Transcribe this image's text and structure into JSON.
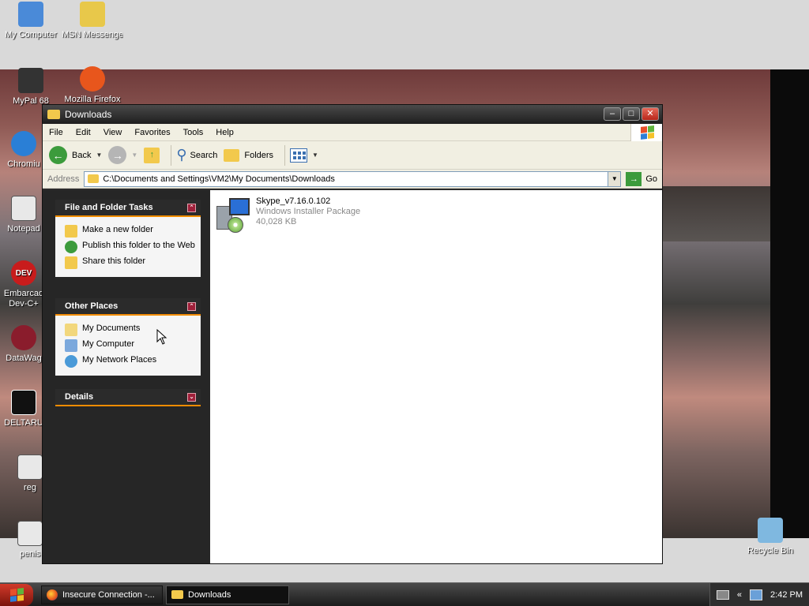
{
  "desktop": {
    "icons": [
      {
        "label": "My Computer",
        "icon": "computer-icon",
        "color": "#4a8ad8"
      },
      {
        "label": "MSN Messenger ...",
        "icon": "zip-folder-icon",
        "color": "#e8c84a"
      },
      {
        "label": "MyPal 68",
        "icon": "mypal-icon",
        "color": "#333333"
      },
      {
        "label": "Mozilla Firefox",
        "icon": "firefox-icon",
        "color": "#e8561c"
      },
      {
        "label": "Chromiu",
        "icon": "chromium-icon",
        "color": "#2a7fd6"
      },
      {
        "label": "Notepad",
        "icon": "notepad-icon",
        "color": "#e8e8e8"
      },
      {
        "label": "Embarcad Dev-C+",
        "icon": "devcpp-icon",
        "color": "#c81c1c",
        "badge": "DEV"
      },
      {
        "label": "DataWag",
        "icon": "datawagon-icon",
        "color": "#8a1c2c"
      },
      {
        "label": "DELTARU",
        "icon": "deltarune-icon",
        "color": "#111111"
      },
      {
        "label": "reg",
        "icon": "registry-icon",
        "color": "#e8e8e8"
      },
      {
        "label": "penis",
        "icon": "game-icon",
        "color": "#e8e8e8"
      },
      {
        "label": "Recycle Bin",
        "icon": "recycle-bin-icon",
        "color": "#7fb8e0"
      }
    ]
  },
  "window": {
    "title": "Downloads",
    "minimize": "–",
    "maximize": "□",
    "close": "✕"
  },
  "menu": [
    "File",
    "Edit",
    "View",
    "Favorites",
    "Tools",
    "Help"
  ],
  "toolbar": {
    "back": "Back",
    "search": "Search",
    "folders": "Folders"
  },
  "address": {
    "label": "Address",
    "value": "C:\\Documents and Settings\\VM2\\My Documents\\Downloads",
    "go": "Go"
  },
  "panels": {
    "tasks": {
      "title": "File and Folder Tasks",
      "items": [
        {
          "label": "Make a new folder",
          "icon": "new-folder-icon",
          "color": "#f2c94c"
        },
        {
          "label": "Publish this folder to the Web",
          "icon": "publish-web-icon",
          "color": "#3c9b3c"
        },
        {
          "label": "Share this folder",
          "icon": "share-folder-icon",
          "color": "#f2c94c"
        }
      ]
    },
    "places": {
      "title": "Other Places",
      "items": [
        {
          "label": "My Documents",
          "icon": "my-documents-icon",
          "color": "#f2d77c"
        },
        {
          "label": "My Computer",
          "icon": "my-computer-icon",
          "color": "#7ba8dc"
        },
        {
          "label": "My Network Places",
          "icon": "network-places-icon",
          "color": "#4a9ad8"
        }
      ]
    },
    "details": {
      "title": "Details"
    }
  },
  "files": [
    {
      "name": "Skype_v7.16.0.102",
      "type": "Windows Installer Package",
      "size": "40,028 KB"
    }
  ],
  "taskbar": {
    "buttons": [
      {
        "label": "Insecure Connection -..."
      },
      {
        "label": "Downloads"
      }
    ],
    "clock": "2:42 PM",
    "tray_chevron": "«"
  }
}
